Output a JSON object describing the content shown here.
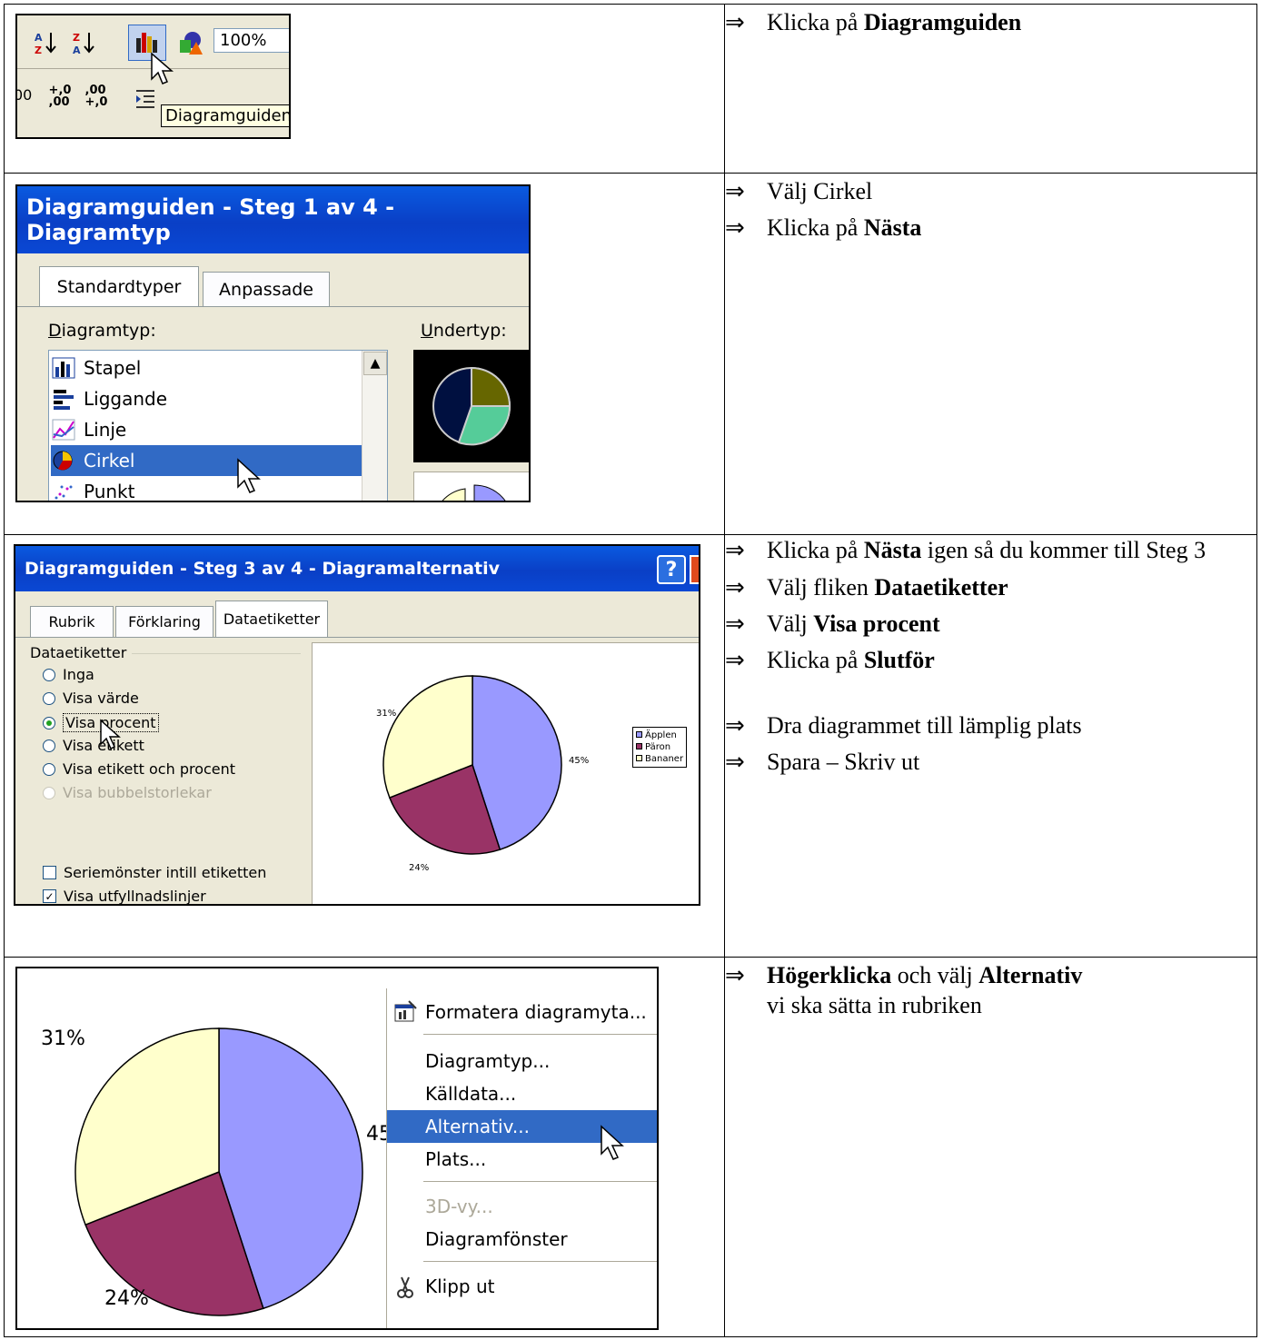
{
  "arrow": "⇒",
  "row1": {
    "toolbar": {
      "sort_asc_icon": "sort-ascending-icon",
      "sort_desc_icon": "sort-descending-icon",
      "chart_wizard_icon": "chart-wizard-icon",
      "drawing_icon": "drawing-icon",
      "zoom": "100%",
      "dec_inc": "+,0\n,00",
      "dec_dec": ",00\n+,0",
      "tooltip": "Diagramguiden",
      "partial_left": "00"
    },
    "steps": [
      {
        "pre": "Klicka på ",
        "bold": "Diagramguiden",
        "post": ""
      }
    ]
  },
  "row2": {
    "dialog": {
      "title": "Diagramguiden - Steg 1 av 4 - Diagramtyp",
      "tabs": [
        "Standardtyper",
        "Anpassade"
      ],
      "list_label": "Diagramtyp:",
      "list_label_u": "D",
      "subtype_label": "Undertyp:",
      "types": [
        "Stapel",
        "Liggande",
        "Linje",
        "Cirkel",
        "Punkt"
      ],
      "selected": "Cirkel"
    },
    "steps": [
      {
        "pre": "Välj Cirkel",
        "bold": "",
        "post": ""
      },
      {
        "pre": "Klicka på ",
        "bold": "Nästa",
        "post": ""
      }
    ]
  },
  "row3": {
    "dialog": {
      "title": "Diagramguiden - Steg 3 av 4 - Diagramalternativ",
      "help": "?",
      "tabs": [
        "Rubrik",
        "Förklaring",
        "Dataetiketter"
      ],
      "group_label": "Dataetiketter",
      "options": [
        "Inga",
        "Visa värde",
        "Visa procent",
        "Visa etikett",
        "Visa etikett och procent",
        "Visa bubbelstorlekar"
      ],
      "checkbox1": "Seriemönster intill etiketten",
      "checkbox2": "Visa utfyllnadslinjer",
      "legend": [
        "Äpplen",
        "Päron",
        "Bananer"
      ]
    },
    "steps": [
      {
        "pre": "Klicka på ",
        "bold": "Nästa",
        "post": " igen så du kommer till Steg 3"
      },
      {
        "pre": "Välj fliken ",
        "bold": "Dataetiketter",
        "post": ""
      },
      {
        "pre": "Välj ",
        "bold": "Visa procent",
        "post": ""
      },
      {
        "pre": "Klicka på ",
        "bold": "Slutför",
        "post": ""
      },
      {
        "pre": "Dra diagrammet till lämplig plats",
        "bold": "",
        "post": ""
      },
      {
        "pre": "Spara – Skriv ut",
        "bold": "",
        "post": ""
      }
    ]
  },
  "row4": {
    "menu": [
      "Formatera diagramyta...",
      "Diagramtyp...",
      "Källdata...",
      "Alternativ...",
      "Plats...",
      "3D-vy...",
      "Diagramfönster",
      "Klipp ut"
    ],
    "menu_selected": "Alternativ...",
    "menu_disabled": "3D-vy...",
    "partial_label": "45",
    "steps_bold1": "Högerklicka",
    "steps_mid": " och välj ",
    "steps_bold2": "Alternativ",
    "steps_note": "vi ska sätta in rubriken"
  },
  "colors": {
    "apples": "#9999ff",
    "pears": "#993366",
    "bananas": "#ffffcc",
    "selection": "#316ac5",
    "titlebar": "#0a48d4"
  },
  "chart_data": {
    "type": "pie",
    "categories": [
      "Äpplen",
      "Päron",
      "Bananer"
    ],
    "values": [
      45,
      24,
      31
    ],
    "labels": [
      "45%",
      "24%",
      "31%"
    ],
    "legend": "right"
  }
}
